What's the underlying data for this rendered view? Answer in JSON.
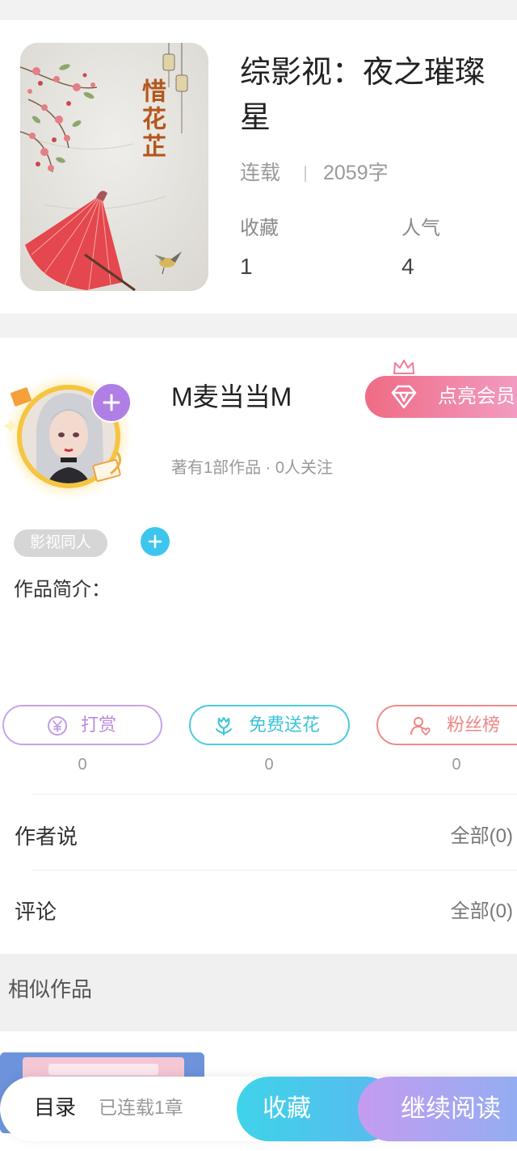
{
  "book": {
    "title": "综影视：夜之璀璨星",
    "status": "连载",
    "word_count": "2059字",
    "cover": {
      "calligraphy": "惜花芷"
    },
    "stats": [
      {
        "label": "收藏",
        "value": "1"
      },
      {
        "label": "人气",
        "value": "4"
      }
    ]
  },
  "author": {
    "name": "M麦当当M",
    "meta": "著有1部作品 · 0人关注",
    "vip_button": "点亮会员",
    "follow_icon": "plus-icon"
  },
  "tags": [
    "影视同人"
  ],
  "intro_label": "作品简介：",
  "actions": [
    {
      "label": "打赏",
      "count": "0",
      "icon": "yuan-coin-icon",
      "color": "#c6a0e8"
    },
    {
      "label": "免费送花",
      "count": "0",
      "icon": "flower-icon",
      "color": "#4ccbdf"
    },
    {
      "label": "粉丝榜",
      "count": "0",
      "icon": "fan-rank-icon",
      "color": "#ef8b8b"
    }
  ],
  "sections": [
    {
      "title": "作者说",
      "link": "全部(0)"
    },
    {
      "title": "评论",
      "link": "全部(0)"
    }
  ],
  "similar": {
    "title": "相似作品"
  },
  "bottom_bar": {
    "catalog": "目录",
    "progress": "已连载1章",
    "favorite": "收藏",
    "continue": "继续阅读"
  },
  "colors": {
    "vip_gradient_start": "#ef6b84",
    "vip_gradient_end": "#f29bc1",
    "follow_plus": "#b07fe6",
    "tag_add": "#3ec5ee",
    "favorite_button": "#3fd3e9",
    "continue_button": "#c49cf0"
  }
}
